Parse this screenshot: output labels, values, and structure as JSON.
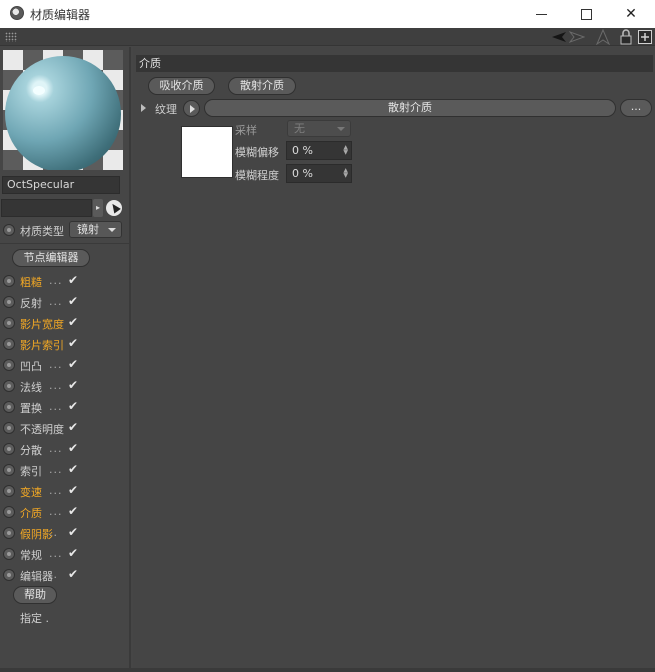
{
  "window": {
    "title": "材质编辑器",
    "buttons": [
      "minimize",
      "maximize",
      "close"
    ]
  },
  "toolbar": {
    "icons": [
      "back-arrow-icon",
      "forward-arrow-icon",
      "up-arrow-icon",
      "lock-icon",
      "new-window-icon"
    ]
  },
  "material": {
    "name": "OctSpecular",
    "type_label": "材质类型",
    "type_value": "镜射",
    "node_editor_label": "节点编辑器"
  },
  "channels": [
    {
      "label": "粗糙",
      "dots": "...",
      "active": true,
      "checked": true
    },
    {
      "label": "反射",
      "dots": "...",
      "active": false,
      "checked": true
    },
    {
      "label": "影片宽度",
      "dots": "",
      "active": true,
      "checked": true
    },
    {
      "label": "影片索引",
      "dots": "",
      "active": true,
      "checked": true
    },
    {
      "label": "凹凸",
      "dots": "...",
      "active": false,
      "checked": true
    },
    {
      "label": "法线",
      "dots": "...",
      "active": false,
      "checked": true
    },
    {
      "label": "置换",
      "dots": "...",
      "active": false,
      "checked": true
    },
    {
      "label": "不透明度",
      "dots": "",
      "active": false,
      "checked": true
    },
    {
      "label": "分散",
      "dots": "...",
      "active": false,
      "checked": true
    },
    {
      "label": "索引",
      "dots": "...",
      "active": false,
      "checked": true
    },
    {
      "label": "变速",
      "dots": "...",
      "active": true,
      "checked": true
    },
    {
      "label": "介质",
      "dots": "...",
      "active": true,
      "checked": true
    },
    {
      "label": "假阴影",
      "dots": "..",
      "active": true,
      "checked": true
    },
    {
      "label": "常规",
      "dots": "...",
      "active": false,
      "checked": true
    },
    {
      "label": "编辑器",
      "dots": "..",
      "active": false,
      "checked": true
    }
  ],
  "help_label": "帮助",
  "assign_label": "指定 .",
  "medium": {
    "section_title": "介质",
    "absorb_btn": "吸收介质",
    "scatter_btn": "散射介质",
    "texture_label": "纹理",
    "texture_btn": "散射介质",
    "more_btn": "...",
    "sampling_label": "采样",
    "sampling_value": "无",
    "blur_offset_label": "模糊偏移",
    "blur_offset_value": "0 %",
    "blur_amount_label": "模糊程度",
    "blur_amount_value": "0 %"
  },
  "colors": {
    "active_channel": "#f2a824",
    "panel_bg": "#464646",
    "field_bg": "#353535"
  }
}
